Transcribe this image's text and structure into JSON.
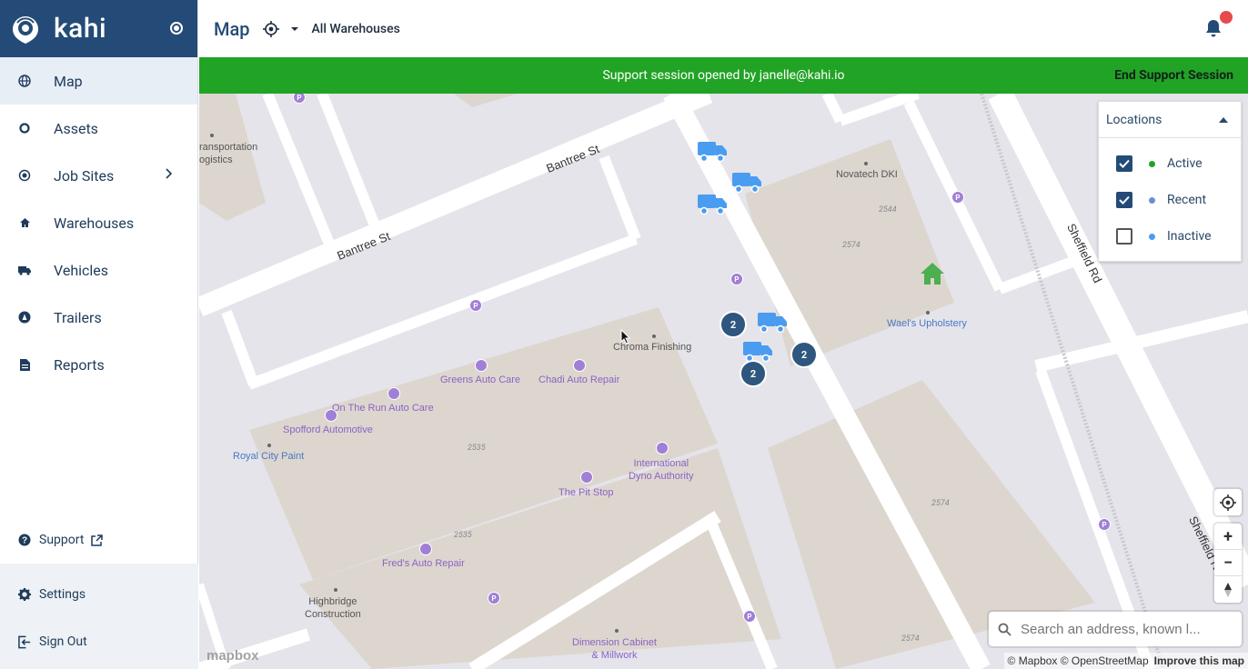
{
  "brand": {
    "name": "kahi"
  },
  "nav": {
    "items": [
      {
        "label": "Map",
        "icon": "globe-icon"
      },
      {
        "label": "Assets",
        "icon": "tag-icon"
      },
      {
        "label": "Job Sites",
        "icon": "target-icon"
      },
      {
        "label": "Warehouses",
        "icon": "home-icon"
      },
      {
        "label": "Vehicles",
        "icon": "truck-icon"
      },
      {
        "label": "Trailers",
        "icon": "trailer-icon"
      },
      {
        "label": "Reports",
        "icon": "document-icon"
      }
    ],
    "support": "Support",
    "settings": "Settings",
    "signout": "Sign Out"
  },
  "topbar": {
    "title": "Map",
    "warehouse_filter": "All Warehouses"
  },
  "banner": {
    "message": "Support session opened by janelle@kahi.io",
    "end_label": "End Support Session"
  },
  "legend": {
    "title": "Locations",
    "items": [
      {
        "label": "Active",
        "checked": true,
        "color": "#21a325"
      },
      {
        "label": "Recent",
        "checked": true,
        "color": "#6a8fd6"
      },
      {
        "label": "Inactive",
        "checked": false,
        "color": "#4a9cf0"
      }
    ]
  },
  "map": {
    "streets": {
      "s1": "Bantree St",
      "s2": "Bantree St",
      "s3": "Sheffield Rd",
      "s4": "Sheffield Rd"
    },
    "labels": {
      "transport": "ransportation\nogistics",
      "novatech": "Novatech DKI",
      "wael": "Wael's Upholstery",
      "chroma": "Chroma Finishing",
      "greens": "Greens Auto Care",
      "chadi": "Chadi Auto Repair",
      "ontherun": "On The Run Auto Care",
      "spofford": "Spofford Automotive",
      "royal": "Royal City Paint",
      "intl": "International\nDyno Authority",
      "pitstop": "The Pit Stop",
      "freds": "Fred's Auto Repair",
      "highbridge": "Highbridge\nConstruction",
      "dimension": "Dimension Cabinet\n& Millwork"
    },
    "numbers": {
      "n1": "2544",
      "n2": "2574",
      "n3": "2535",
      "n4": "2535",
      "n5": "2574",
      "n6": "2574"
    },
    "clusters": [
      "2",
      "2",
      "2"
    ],
    "search_placeholder": "Search an address, known l...",
    "attribution": "© Mapbox © OpenStreetMap",
    "improve": "Improve this map",
    "mapbox_logo": "mapbox"
  }
}
